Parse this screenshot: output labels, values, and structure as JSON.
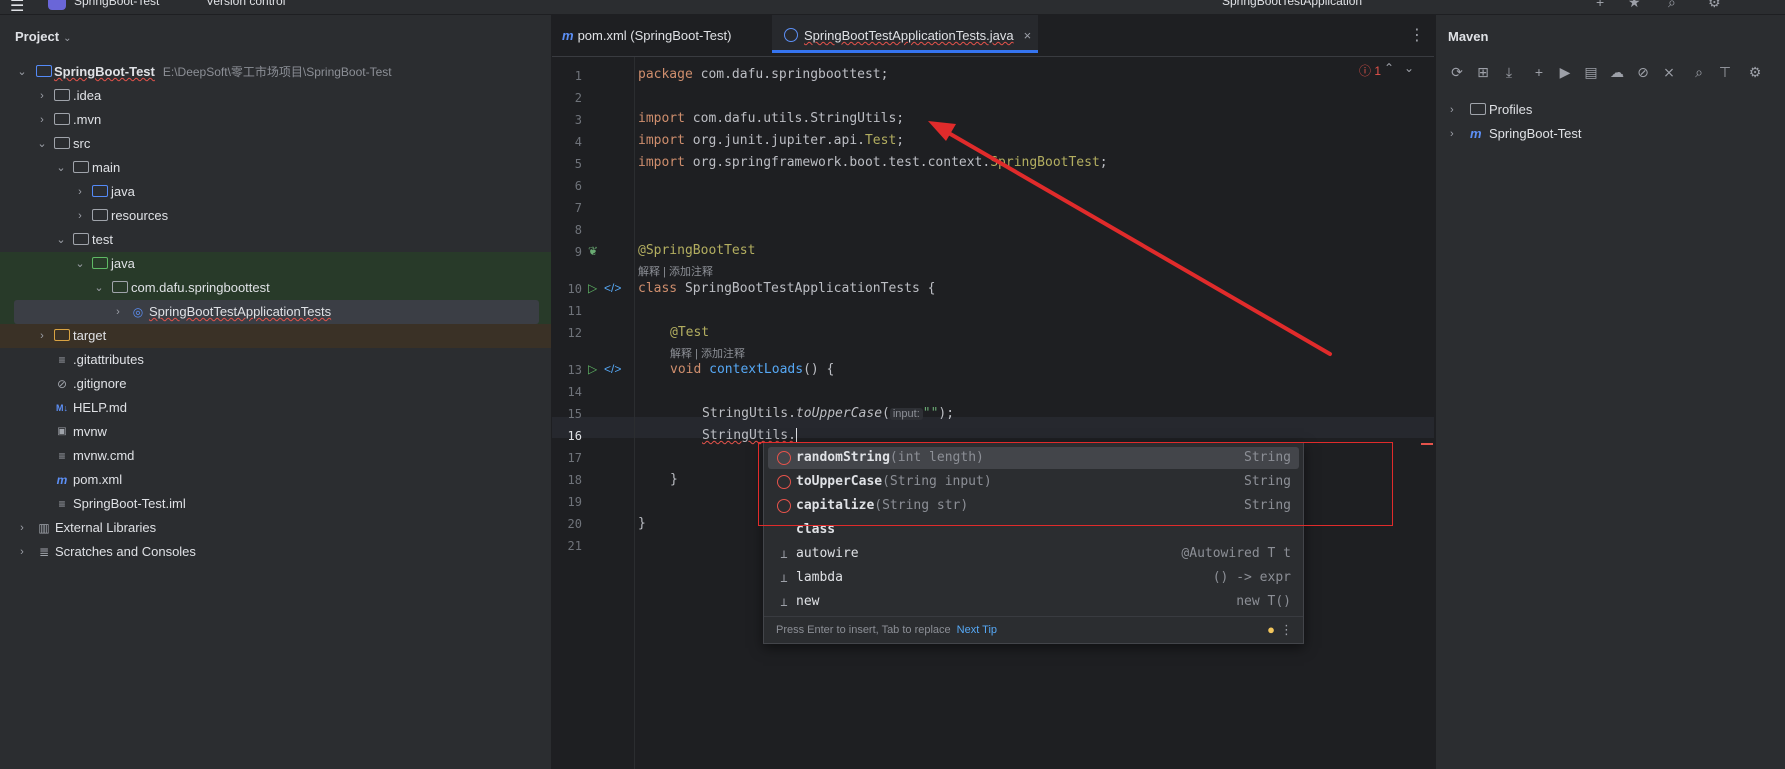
{
  "topbar": {
    "project_name": "SpringBoot-Test",
    "version_control": "Version control",
    "run_config": "SpringBootTestApplication"
  },
  "project_panel": {
    "title": "Project",
    "tree": [
      {
        "label": "SpringBoot-Test",
        "path": "E:\\DeepSoft\\零工市场项目\\SpringBoot-Test",
        "depth": 0,
        "expanded": true,
        "icon": "module-folder-icon"
      },
      {
        "label": ".idea",
        "depth": 1,
        "expanded": false,
        "icon": "folder-icon"
      },
      {
        "label": ".mvn",
        "depth": 1,
        "expanded": false,
        "icon": "folder-icon"
      },
      {
        "label": "src",
        "depth": 1,
        "expanded": true,
        "icon": "folder-icon"
      },
      {
        "label": "main",
        "depth": 2,
        "expanded": true,
        "icon": "folder-icon"
      },
      {
        "label": "java",
        "depth": 3,
        "expanded": false,
        "icon": "source-folder-icon"
      },
      {
        "label": "resources",
        "depth": 3,
        "expanded": false,
        "icon": "resources-folder-icon"
      },
      {
        "label": "test",
        "depth": 2,
        "expanded": true,
        "icon": "folder-icon"
      },
      {
        "label": "java",
        "depth": 3,
        "expanded": true,
        "icon": "test-folder-icon"
      },
      {
        "label": "com.dafu.springboottest",
        "depth": 4,
        "expanded": true,
        "icon": "package-icon"
      },
      {
        "label": "SpringBootTestApplicationTests",
        "depth": 5,
        "expanded": false,
        "icon": "class-icon"
      },
      {
        "label": "target",
        "depth": 1,
        "expanded": false,
        "icon": "excluded-folder-icon"
      },
      {
        "label": ".gitattributes",
        "depth": 2,
        "icon": "text-file-icon"
      },
      {
        "label": ".gitignore",
        "depth": 2,
        "icon": "ignore-file-icon"
      },
      {
        "label": "HELP.md",
        "depth": 2,
        "icon": "markdown-file-icon"
      },
      {
        "label": "mvnw",
        "depth": 2,
        "icon": "shell-file-icon"
      },
      {
        "label": "mvnw.cmd",
        "depth": 2,
        "icon": "text-file-icon"
      },
      {
        "label": "pom.xml",
        "depth": 2,
        "icon": "maven-file-icon"
      },
      {
        "label": "SpringBoot-Test.iml",
        "depth": 2,
        "icon": "iml-file-icon"
      },
      {
        "label": "External Libraries",
        "depth": 0,
        "expanded": false,
        "icon": "libraries-icon"
      },
      {
        "label": "Scratches and Consoles",
        "depth": 0,
        "expanded": false,
        "icon": "scratches-icon"
      }
    ]
  },
  "editor": {
    "tabs": [
      {
        "label": "pom.xml (SpringBoot-Test)",
        "active": false
      },
      {
        "label": "SpringBootTestApplicationTests.java",
        "active": true
      }
    ],
    "error_count": "1",
    "line_numbers": [
      "1",
      "2",
      "3",
      "4",
      "5",
      "6",
      "7",
      "8",
      "9",
      "10",
      "11",
      "12",
      "13",
      "14",
      "15",
      "16",
      "17",
      "18",
      "19",
      "20",
      "21"
    ],
    "code": {
      "l1_kw": "package",
      "l1_rest": " com.dafu.springboottest;",
      "l3_kw": "import",
      "l3_rest": " com.dafu.utils.StringUtils;",
      "l4_kw": "import",
      "l4_rest": " org.junit.jupiter.api.",
      "l4_ann": "Test",
      "l4_end": ";",
      "l5_kw": "import",
      "l5_rest": " org.springframework.boot.test.context.",
      "l5_ann": "SpringBootTest",
      "l5_end": ";",
      "l9": "@SpringBootTest",
      "lens1": "解释 | 添加注释",
      "l10_kw": "class",
      "l10_rest": " SpringBootTestApplicationTests {",
      "l12": "@Test",
      "lens2": "解释 | 添加注释",
      "l13_kw": "void",
      "l13_fn": "contextLoads",
      "l13_rest": "() {",
      "l15_obj": "StringUtils.",
      "l15_fn": "toUpperCase",
      "l15_open": "(",
      "l15_hint": "input:",
      "l15_str": "\"\"",
      "l15_end": ");",
      "l16": "StringUtils.",
      "l18": "}",
      "l20": "}"
    }
  },
  "completion": {
    "items": [
      {
        "name": "randomString",
        "sig": "(int length)",
        "type": "String",
        "kind": "method"
      },
      {
        "name": "toUpperCase",
        "sig": "(String input)",
        "type": "String",
        "kind": "method"
      },
      {
        "name": "capitalize",
        "sig": "(String str)",
        "type": "String",
        "kind": "method"
      },
      {
        "name": "class",
        "sig": "",
        "type": "",
        "kind": "keyword"
      },
      {
        "name": "autowire",
        "sig": "",
        "type": "@Autowired T t",
        "kind": "template"
      },
      {
        "name": "lambda",
        "sig": "",
        "type": "() -> expr",
        "kind": "template"
      },
      {
        "name": "new",
        "sig": "",
        "type": "new T()",
        "kind": "template"
      }
    ],
    "footer_text": "Press Enter to insert, Tab to replace",
    "next_tip": "Next Tip"
  },
  "maven_panel": {
    "title": "Maven",
    "items": [
      {
        "label": "Profiles",
        "icon": "folder-icon"
      },
      {
        "label": "SpringBoot-Test",
        "icon": "maven-module-icon"
      }
    ]
  },
  "colors": {
    "accent": "#3574f0",
    "annotation_red": "#e02b2b"
  }
}
